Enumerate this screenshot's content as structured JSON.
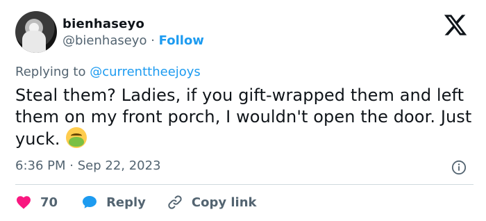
{
  "user": {
    "display_name": "bienhaseyo",
    "handle": "@bienhaseyo",
    "separator": "·",
    "follow_label": "Follow"
  },
  "reply_context": {
    "prefix": "Replying to",
    "mention": "@currenttheejoys"
  },
  "tweet": {
    "text": "Steal them? Ladies, if you gift-wrapped them and left them on my front porch, I wouldn't open the door. Just yuck.",
    "emoji": "nauseated-face"
  },
  "meta": {
    "time": "6:36 PM",
    "separator": "·",
    "date": "Sep 22, 2023"
  },
  "actions": {
    "like_count": "70",
    "reply_label": "Reply",
    "copy_label": "Copy link"
  },
  "colors": {
    "accent": "#1d9bf0",
    "like": "#f91880",
    "text": "#0f1419",
    "muted": "#536471"
  }
}
